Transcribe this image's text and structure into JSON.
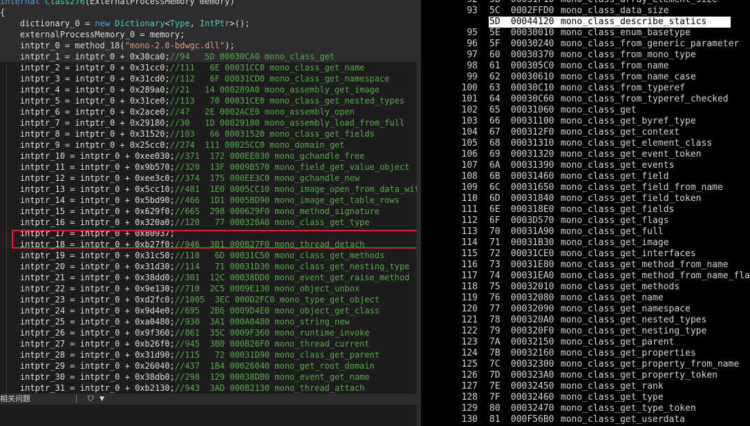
{
  "editor": {
    "lines": [
      [
        [
          "kw",
          "internal "
        ],
        [
          "ty",
          "Class276"
        ],
        [
          "",
          "(ExternalProcessMemory memory)"
        ]
      ],
      [
        [
          "",
          "{"
        ]
      ],
      [
        [
          "",
          "    dictionary_0 = "
        ],
        [
          "kw",
          "new "
        ],
        [
          "ty",
          "Dictionary"
        ],
        [
          "",
          "<"
        ],
        [
          "ty",
          "Type"
        ],
        [
          "",
          ", "
        ],
        [
          "ty",
          "IntPtr"
        ],
        [
          "",
          ">();"
        ]
      ],
      [
        [
          "",
          "    externalProcessMemory_0 = memory;"
        ]
      ],
      [
        [
          "",
          "    intptr_0 = method_18("
        ],
        [
          "str",
          "\"mono-2.0-bdwgc.dll\""
        ],
        [
          "",
          ");"
        ]
      ],
      [
        [
          "",
          "    intptr_1 = intptr_0 + 0x30ca0;"
        ],
        [
          "cm",
          "//94   5D 00030CA0 mono_class_get"
        ]
      ],
      [
        [
          "",
          "    intptr_2 = intptr_0 + 0x31cc0;"
        ],
        [
          "cm",
          "//111   6E 00031CC0 mono_class_get_name"
        ]
      ],
      [
        [
          "",
          "    intptr_3 = intptr_0 + 0x31cd0;"
        ],
        [
          "cm",
          "//112   6F 00031CD0 mono_class_get_namespace"
        ]
      ],
      [
        [
          "",
          "    intptr_4 = intptr_0 + 0x289a0;"
        ],
        [
          "cm",
          "//21   14 000289A0 mono_assembly_get_image"
        ]
      ],
      [
        [
          "",
          "    intptr_5 = intptr_0 + 0x31ce0;"
        ],
        [
          "cm",
          "//113   70 00031CE0 mono_class_get_nested_types"
        ]
      ],
      [
        [
          "",
          "    intptr_6 = intptr_0 + 0x2ace0;"
        ],
        [
          "cm",
          "//47   2E 0002ACE0 mono_assembly_open"
        ]
      ],
      [
        [
          "",
          "    intptr_7 = intptr_0 + 0x29180;"
        ],
        [
          "cm",
          "//30   1D 00029180 mono_assembly_load_from_full"
        ]
      ],
      [
        [
          "",
          "    intptr_8 = intptr_0 + 0x31520;"
        ],
        [
          "cm",
          "//103   66 00031520 mono_class_get_fields"
        ]
      ],
      [
        [
          "",
          "    intptr_9 = intptr_0 + 0x25cc0;"
        ],
        [
          "cm",
          "//274  111 00025CC0 mono_domain_get"
        ]
      ],
      [
        [
          "",
          "    intptr_10 = intptr_0 + 0xee030;"
        ],
        [
          "cm",
          "//371  172 000EE030 mono_gchandle_free"
        ]
      ],
      [
        [
          "",
          "    intptr_11 = intptr_0 + 0x9b570;"
        ],
        [
          "cm",
          "//320  13F 0009B570 mono_field_get_value_object"
        ]
      ],
      [
        [
          "",
          "    intptr_12 = intptr_0 + 0xee3c0;"
        ],
        [
          "cm",
          "//374  175 000EE3C0 mono_gchandle_new"
        ]
      ],
      [
        [
          "",
          "    intptr_13 = intptr_0 + 0x5cc10;"
        ],
        [
          "cm",
          "//481  1E0 0005CC10 mono_image_open_from_data_wit"
        ]
      ],
      [
        [
          "",
          "    intptr_14 = intptr_0 + 0x5bd90;"
        ],
        [
          "cm",
          "//466  1D1 0005BD90 mono_image_get_table_rows"
        ]
      ],
      [
        [
          "",
          "    intptr_15 = intptr_0 + 0x629f0;"
        ],
        [
          "cm",
          "//665  298 000629F0 mono_method_signature"
        ]
      ],
      [
        [
          "",
          "    intptr_16 = intptr_0 + 0x320a0;"
        ],
        [
          "cm",
          "//120   77 000320A0 mono_class_get_type"
        ]
      ],
      [
        [
          "",
          "    intptr_17 = intptr_0 + 0x80937;"
        ]
      ],
      [
        [
          "",
          "    intptr_18 = intptr_0 + 0xb27f0;"
        ],
        [
          "cm",
          "//946  3B1 000B27F0 mono_thread_detach"
        ]
      ],
      [
        [
          "",
          "    intptr_19 = intptr_0 + 0x31c50;"
        ],
        [
          "cm",
          "//110   6D 00031C50 mono_class_get_methods"
        ]
      ],
      [
        [
          "",
          "    intptr_20 = intptr_0 + 0x31d30;"
        ],
        [
          "cm",
          "//114   71 00031D30 mono_class_get_nesting_type"
        ]
      ],
      [
        [
          "",
          "    intptr_21 = intptr_0 + 0x38dd0;"
        ],
        [
          "cm",
          "//301  12C 00038DD0 mono_event_get_raise_method"
        ]
      ],
      [
        [
          "",
          "    intptr_22 = intptr_0 + 0x9e130;"
        ],
        [
          "cm",
          "//710  2C5 0009E130 mono_object_unbox"
        ]
      ],
      [
        [
          "",
          "    intptr_23 = intptr_0 + 0xd2fc0;"
        ],
        [
          "cm",
          "//1005  3EC 000D2FC0 mono_type_get_object"
        ]
      ],
      [
        [
          "",
          "    intptr_24 = intptr_0 + 0x9d4e0;"
        ],
        [
          "cm",
          "//695  2B6 0009D4E0 mono_object_get_class"
        ]
      ],
      [
        [
          "",
          "    intptr_25 = intptr_0 + 0xa0480;"
        ],
        [
          "cm",
          "//930  3A1 000A0480 mono_string_new"
        ]
      ],
      [
        [
          "",
          "    intptr_26 = intptr_0 + 0x9f360;"
        ],
        [
          "cm",
          "//861  35C 0009F360 mono_runtime_invoke"
        ]
      ],
      [
        [
          "",
          "    intptr_27 = intptr_0 + 0xb26f0;"
        ],
        [
          "cm",
          "//945  3B0 000B26F0 mono_thread_current"
        ]
      ],
      [
        [
          "",
          "    intptr_28 = intptr_0 + 0x31d90;"
        ],
        [
          "cm",
          "//115   72 00031D90 mono_class_get_parent"
        ]
      ],
      [
        [
          "",
          "    intptr_29 = intptr_0 + 0x26040;"
        ],
        [
          "cm",
          "//437  1B4 00026040 mono_get_root_domain"
        ]
      ],
      [
        [
          "",
          "    intptr_30 = intptr_0 + 0x38db0;"
        ],
        [
          "cm",
          "//298  129 00038DB0 mono_event_get_name"
        ]
      ],
      [
        [
          "",
          "    intptr_31 = intptr_0 + 0xb2130;"
        ],
        [
          "cm",
          "//943  3AD 000B2130 mono_thread_attach"
        ]
      ]
    ],
    "highlight_lines": [
      0,
      1,
      2,
      3,
      4,
      5
    ]
  },
  "statusbar": {
    "label": "相关问题",
    "filter_icon": "filter-icon",
    "dropdown_icon": "chevron-down-icon"
  },
  "export_table": {
    "selected_index": 2,
    "rows": [
      {
        "num": "92",
        "ord": "5B",
        "addr": "00031F10",
        "name": "mono_class_array_element_size"
      },
      {
        "num": "93",
        "ord": "5C",
        "addr": "0002FFD0",
        "name": "mono_class_data_size"
      },
      {
        "num": "94",
        "ord": "5D",
        "addr": "00044120",
        "name": "mono_class_describe_statics"
      },
      {
        "num": "95",
        "ord": "5E",
        "addr": "00030010",
        "name": "mono_class_enum_basetype"
      },
      {
        "num": "96",
        "ord": "5F",
        "addr": "00030240",
        "name": "mono_class_from_generic_parameter"
      },
      {
        "num": "97",
        "ord": "60",
        "addr": "00030370",
        "name": "mono_class_from_mono_type"
      },
      {
        "num": "98",
        "ord": "61",
        "addr": "000305C0",
        "name": "mono_class_from_name"
      },
      {
        "num": "99",
        "ord": "62",
        "addr": "00030610",
        "name": "mono_class_from_name_case"
      },
      {
        "num": "100",
        "ord": "63",
        "addr": "00030C10",
        "name": "mono_class_from_typeref"
      },
      {
        "num": "101",
        "ord": "64",
        "addr": "00030C60",
        "name": "mono_class_from_typeref_checked"
      },
      {
        "num": "102",
        "ord": "65",
        "addr": "00031060",
        "name": "mono_class_get"
      },
      {
        "num": "103",
        "ord": "66",
        "addr": "00031100",
        "name": "mono_class_get_byref_type"
      },
      {
        "num": "104",
        "ord": "67",
        "addr": "000312F0",
        "name": "mono_class_get_context"
      },
      {
        "num": "105",
        "ord": "68",
        "addr": "00031310",
        "name": "mono_class_get_element_class"
      },
      {
        "num": "106",
        "ord": "69",
        "addr": "00031320",
        "name": "mono_class_get_event_token"
      },
      {
        "num": "107",
        "ord": "6A",
        "addr": "00031390",
        "name": "mono_class_get_events"
      },
      {
        "num": "108",
        "ord": "6B",
        "addr": "00031460",
        "name": "mono_class_get_field"
      },
      {
        "num": "109",
        "ord": "6C",
        "addr": "00031650",
        "name": "mono_class_get_field_from_name"
      },
      {
        "num": "110",
        "ord": "6D",
        "addr": "00031840",
        "name": "mono_class_get_field_token"
      },
      {
        "num": "111",
        "ord": "6E",
        "addr": "000318E0",
        "name": "mono_class_get_fields"
      },
      {
        "num": "112",
        "ord": "6F",
        "addr": "0003D570",
        "name": "mono_class_get_flags"
      },
      {
        "num": "113",
        "ord": "70",
        "addr": "00031A90",
        "name": "mono_class_get_full"
      },
      {
        "num": "114",
        "ord": "71",
        "addr": "00031B30",
        "name": "mono_class_get_image"
      },
      {
        "num": "115",
        "ord": "72",
        "addr": "00031CE0",
        "name": "mono_class_get_interfaces"
      },
      {
        "num": "116",
        "ord": "73",
        "addr": "00031E80",
        "name": "mono_class_get_method_from_name"
      },
      {
        "num": "117",
        "ord": "74",
        "addr": "00031EA0",
        "name": "mono_class_get_method_from_name_fla"
      },
      {
        "num": "118",
        "ord": "75",
        "addr": "00032010",
        "name": "mono_class_get_methods"
      },
      {
        "num": "119",
        "ord": "76",
        "addr": "00032080",
        "name": "mono_class_get_name"
      },
      {
        "num": "120",
        "ord": "77",
        "addr": "00032090",
        "name": "mono_class_get_namespace"
      },
      {
        "num": "121",
        "ord": "78",
        "addr": "000320A0",
        "name": "mono_class_get_nested_types"
      },
      {
        "num": "122",
        "ord": "79",
        "addr": "000320F0",
        "name": "mono_class_get_nesting_type"
      },
      {
        "num": "123",
        "ord": "7A",
        "addr": "00032150",
        "name": "mono_class_get_parent"
      },
      {
        "num": "124",
        "ord": "7B",
        "addr": "00032160",
        "name": "mono_class_get_properties"
      },
      {
        "num": "125",
        "ord": "7C",
        "addr": "00032300",
        "name": "mono_class_get_property_from_name"
      },
      {
        "num": "126",
        "ord": "7D",
        "addr": "000323A0",
        "name": "mono_class_get_property_token"
      },
      {
        "num": "127",
        "ord": "7E",
        "addr": "00032450",
        "name": "mono_class_get_rank"
      },
      {
        "num": "128",
        "ord": "7F",
        "addr": "00032460",
        "name": "mono_class_get_type"
      },
      {
        "num": "129",
        "ord": "80",
        "addr": "00032470",
        "name": "mono_class_get_type_token"
      },
      {
        "num": "130",
        "ord": "81",
        "addr": "000F56B0",
        "name": "mono_class_get_userdata"
      }
    ]
  }
}
